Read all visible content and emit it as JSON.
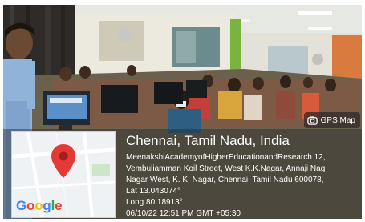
{
  "gps_badge": {
    "label": "GPS Map",
    "icon": "camera-icon"
  },
  "location": {
    "city": "Chennai, Tamil Nadu, India",
    "address_line_1": "MeenakshiAcademyofHigherEducationandResearch 12,",
    "address_line_2": "Vembuliamman Koil Street, West K.K.Nagar, Annaji Nag",
    "address_line_3": "Nagar West, K. K. Nagar, Chennai, Tamil Nadu 600078,",
    "latitude": "Lat 13.043074°",
    "longitude": "Long 80.18913°",
    "datetime": "06/10/22 12:51 PM GMT +05:30"
  },
  "map": {
    "logo_text": "Google",
    "pin_icon": "map-pin-icon",
    "logo_colors": [
      "#4285F4",
      "#EA4335",
      "#FBBC05",
      "#4285F4",
      "#34A853",
      "#EA4335"
    ]
  }
}
